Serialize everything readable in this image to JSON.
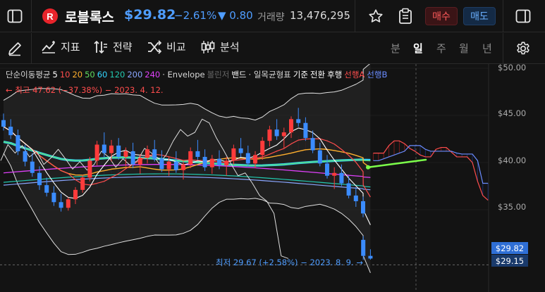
{
  "header": {
    "name": "로블록스",
    "price": "$29.82",
    "change_pct": "−2.61%",
    "change_val": "▼ 0.80",
    "volume_label": "거래량",
    "volume_value": "13,476,295",
    "volume_more": "›",
    "buy_label": "매수",
    "sell_label": "매도"
  },
  "toolbar": {
    "tools": [
      {
        "id": "indicators",
        "label": "지표"
      },
      {
        "id": "strategy",
        "label": "전략"
      },
      {
        "id": "compare",
        "label": "비교"
      },
      {
        "id": "analysis",
        "label": "분석"
      }
    ],
    "timeframes": [
      {
        "label": "분",
        "active": false
      },
      {
        "label": "일",
        "active": true
      },
      {
        "label": "주",
        "active": false
      },
      {
        "label": "월",
        "active": false
      },
      {
        "label": "년",
        "active": false
      }
    ]
  },
  "legend": [
    {
      "text": "단순이동평균",
      "color": "#d8d8d8"
    },
    {
      "text": "5",
      "color": "#ffffff"
    },
    {
      "text": "10",
      "color": "#ff4d4d"
    },
    {
      "text": "20",
      "color": "#ffb02e"
    },
    {
      "text": "50",
      "color": "#5fdc5f"
    },
    {
      "text": "60",
      "color": "#33d6ff"
    },
    {
      "text": "120",
      "color": "#22c9b0"
    },
    {
      "text": "200",
      "color": "#8aa6ff"
    },
    {
      "text": "240",
      "color": "#e040fb"
    },
    {
      "text": "· Envelope",
      "color": "#d8d8d8"
    },
    {
      "text": "볼린저",
      "color": "#666666"
    },
    {
      "text": "밴드",
      "color": "#ffffff"
    },
    {
      "text": "· 일목균형표",
      "color": "#d8d8d8"
    },
    {
      "text": "기준",
      "color": "#ffffff"
    },
    {
      "text": "전환",
      "color": "#ffffff"
    },
    {
      "text": "후행",
      "color": "#ffffff"
    },
    {
      "text": "선행A",
      "color": "#ff4d4d"
    },
    {
      "text": "선행B",
      "color": "#6a8cff"
    }
  ],
  "annotations": {
    "high": "← 최고 47.62 (−37.38%) − 2023. 4. 12.",
    "low": "최저 29.67 (+2.58%) − 2023. 8. 9. →"
  },
  "chart_data": {
    "type": "candlestick",
    "y_axis_ticks": [
      "$50.00",
      "$45.00",
      "$40.00",
      "$35.00"
    ],
    "ylim": [
      28.5,
      50
    ],
    "last_price": "$29.82",
    "current_price": "$29.15",
    "high": 47.62,
    "low": 29.67,
    "candles": [
      [
        44.5,
        45.2,
        43.4,
        43.8
      ],
      [
        43.8,
        44.6,
        42.5,
        42.9
      ],
      [
        42.9,
        43.5,
        40.8,
        41.2
      ],
      [
        41.2,
        41.9,
        39.6,
        40.1
      ],
      [
        40.1,
        41.0,
        38.5,
        38.9
      ],
      [
        38.9,
        39.6,
        37.1,
        37.6
      ],
      [
        37.6,
        38.4,
        36.4,
        36.8
      ],
      [
        36.8,
        37.5,
        35.4,
        35.8
      ],
      [
        35.8,
        36.7,
        34.8,
        35.2
      ],
      [
        35.2,
        36.3,
        34.9,
        36.1
      ],
      [
        36.1,
        37.4,
        35.6,
        37.1
      ],
      [
        37.1,
        38.7,
        36.8,
        38.4
      ],
      [
        38.4,
        40.6,
        38.0,
        40.2
      ],
      [
        40.2,
        42.3,
        39.7,
        41.9
      ],
      [
        41.9,
        43.2,
        40.6,
        41.0
      ],
      [
        41.0,
        42.4,
        40.1,
        41.8
      ],
      [
        41.8,
        42.6,
        40.3,
        40.6
      ],
      [
        40.6,
        41.6,
        39.6,
        41.2
      ],
      [
        41.2,
        42.1,
        39.4,
        39.8
      ],
      [
        39.8,
        40.9,
        38.8,
        40.5
      ],
      [
        40.5,
        41.8,
        39.9,
        41.4
      ],
      [
        41.4,
        42.4,
        40.1,
        40.4
      ],
      [
        40.4,
        41.3,
        39.0,
        39.3
      ],
      [
        39.3,
        40.6,
        38.6,
        40.1
      ],
      [
        40.1,
        41.2,
        38.9,
        39.2
      ],
      [
        39.2,
        40.1,
        38.2,
        39.8
      ],
      [
        39.8,
        41.6,
        39.4,
        41.2
      ],
      [
        41.2,
        42.4,
        40.3,
        40.6
      ],
      [
        40.6,
        41.4,
        39.1,
        39.5
      ],
      [
        39.5,
        40.8,
        38.8,
        40.4
      ],
      [
        40.4,
        41.3,
        39.3,
        39.7
      ],
      [
        39.7,
        40.6,
        38.6,
        40.2
      ],
      [
        40.2,
        41.9,
        39.8,
        41.5
      ],
      [
        41.5,
        42.6,
        40.6,
        41.0
      ],
      [
        41.0,
        41.8,
        39.6,
        39.9
      ],
      [
        39.9,
        41.2,
        39.4,
        40.8
      ],
      [
        40.8,
        42.7,
        40.3,
        42.3
      ],
      [
        42.3,
        43.9,
        41.7,
        43.5
      ],
      [
        43.5,
        44.6,
        42.4,
        42.8
      ],
      [
        42.8,
        43.7,
        41.5,
        43.2
      ],
      [
        43.2,
        44.9,
        42.6,
        44.6
      ],
      [
        44.6,
        45.8,
        43.8,
        44.2
      ],
      [
        44.2,
        44.8,
        42.3,
        42.6
      ],
      [
        42.6,
        43.4,
        41.0,
        41.3
      ],
      [
        41.3,
        42.1,
        39.6,
        39.9
      ],
      [
        39.9,
        40.8,
        38.3,
        38.6
      ],
      [
        38.6,
        39.5,
        37.2,
        38.9
      ],
      [
        38.9,
        39.8,
        37.5,
        37.8
      ],
      [
        37.8,
        38.6,
        36.2,
        36.5
      ],
      [
        36.5,
        37.4,
        35.3,
        35.9
      ],
      [
        35.9,
        36.4,
        34.2,
        34.6
      ],
      [
        31.8,
        32.2,
        29.67,
        30.1
      ],
      [
        30.1,
        30.8,
        29.7,
        29.82
      ]
    ],
    "series": [
      {
        "name": "5",
        "color": "#ffffff"
      },
      {
        "name": "10",
        "color": "#ff4d4d"
      },
      {
        "name": "20",
        "color": "#ffb02e"
      },
      {
        "name": "50",
        "color": "#5fdc5f"
      },
      {
        "name": "60",
        "color": "#33d6ff"
      },
      {
        "name": "120",
        "color": "#22c9b0"
      },
      {
        "name": "200",
        "color": "#8aa6ff"
      },
      {
        "name": "240",
        "color": "#e040fb"
      },
      {
        "name": "선행A",
        "color": "#ff4d4d"
      },
      {
        "name": "선행B",
        "color": "#6a8cff"
      }
    ],
    "span_a": [
      41.0,
      41.0,
      41.0,
      41.8,
      42.3,
      42.3,
      42.0,
      41.5,
      41.2,
      40.8,
      40.6,
      40.6,
      41.4,
      41.6,
      41.6,
      41.1,
      40.6,
      40.6,
      40.6,
      40.0,
      38.0,
      36.5,
      36.0
    ],
    "span_b": [
      40.2,
      40.2,
      40.4,
      40.6,
      40.8,
      41.0,
      41.2,
      41.8,
      41.8,
      41.8,
      41.4,
      41.2,
      41.2,
      41.2,
      41.2,
      41.2,
      41.0,
      40.9,
      40.9,
      40.9,
      40.2,
      37.8,
      37.8
    ],
    "colors": {
      "up": "#ff3b3b",
      "down": "#3b8cff",
      "background": "#131313"
    }
  }
}
